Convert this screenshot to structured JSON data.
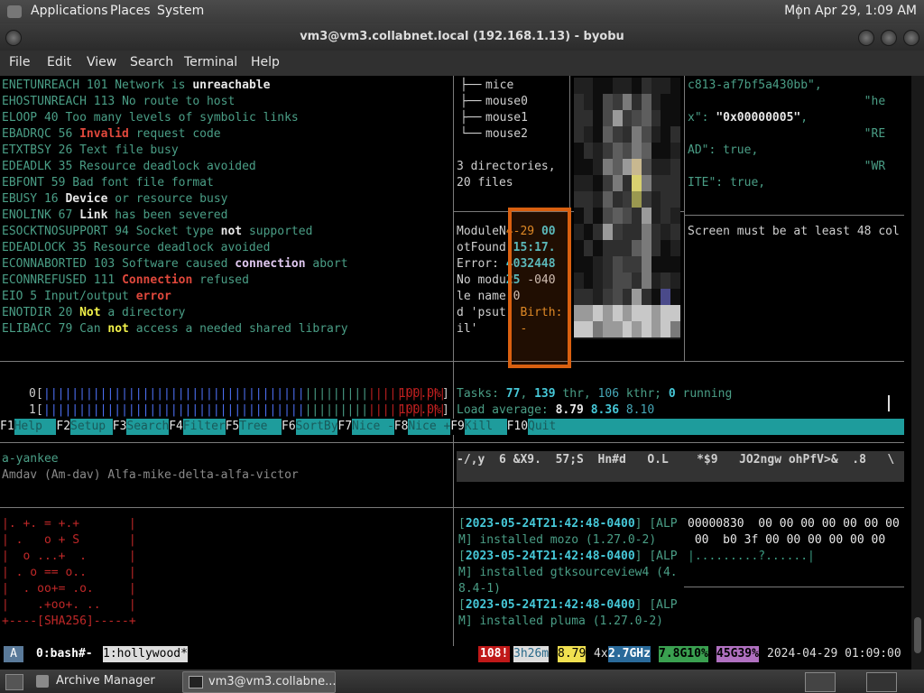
{
  "top_panel": {
    "menus": [
      "Applications",
      "Places",
      "System"
    ],
    "clock": "Mon Apr 29,  1:09 AM"
  },
  "window": {
    "title": "vm3@vm3.collabnet.local (192.168.1.13) - byobu"
  },
  "menubar": [
    "File",
    "Edit",
    "View",
    "Search",
    "Terminal",
    "Help"
  ],
  "errno_pane": [
    [
      [
        "ENETUNREACH 101 ",
        "g"
      ],
      [
        "Network is ",
        "g"
      ],
      [
        "unreachable",
        "w"
      ]
    ],
    [
      [
        "EHOSTUNREACH 113 ",
        "g"
      ],
      [
        "No route to host",
        "g"
      ]
    ],
    [
      [
        "ELOOP 40 ",
        "g"
      ],
      [
        "Too many levels of symbolic links",
        "g"
      ]
    ],
    [
      [
        "EBADRQC 56 ",
        "g"
      ],
      [
        "Invalid",
        "r"
      ],
      [
        " request code",
        "g"
      ]
    ],
    [
      [
        "ETXTBSY 26 ",
        "g"
      ],
      [
        "Text file busy",
        "g"
      ]
    ],
    [
      [
        "EDEADLK 35 ",
        "g"
      ],
      [
        "Resource deadlock avoided",
        "g"
      ]
    ],
    [
      [
        "EBFONT 59 ",
        "g"
      ],
      [
        "Bad font file format",
        "g"
      ]
    ],
    [
      [
        "EBUSY 16 ",
        "g"
      ],
      [
        "Device",
        "w"
      ],
      [
        " or resource busy",
        "g"
      ]
    ],
    [
      [
        "ENOLINK 67 ",
        "g"
      ],
      [
        "Link",
        "w"
      ],
      [
        " has been severed",
        "g"
      ]
    ],
    [
      [
        "ESOCKTNOSUPPORT 94 ",
        "g"
      ],
      [
        "Socket type ",
        "g"
      ],
      [
        "not",
        "w"
      ],
      [
        " supported",
        "g"
      ]
    ],
    [
      [
        "EDEADLOCK 35 ",
        "g"
      ],
      [
        "Resource deadlock avoided",
        "g"
      ]
    ],
    [
      [
        "ECONNABORTED 103 ",
        "g"
      ],
      [
        "Software caused ",
        "g"
      ],
      [
        "connection",
        "pk"
      ],
      [
        " abort",
        "g"
      ]
    ],
    [
      [
        "ECONNREFUSED 111 ",
        "g"
      ],
      [
        "Connection",
        "r"
      ],
      [
        " refused",
        "g"
      ]
    ],
    [
      [
        "EIO 5 ",
        "g"
      ],
      [
        "Input/output ",
        "g"
      ],
      [
        "error",
        "r"
      ]
    ],
    [
      [
        "ENOTDIR 20 ",
        "g"
      ],
      [
        "Not",
        "y"
      ],
      [
        " a directory",
        "g"
      ]
    ],
    [
      [
        "ELIBACC 79 ",
        "g"
      ],
      [
        "Can ",
        "g"
      ],
      [
        "not",
        "y"
      ],
      [
        " access a needed shared library",
        "g"
      ]
    ]
  ],
  "tree_pane": {
    "lines": [
      "mice",
      "mouse0",
      "mouse1",
      "mouse2"
    ],
    "summary": [
      "3 directories,",
      "20 files"
    ]
  },
  "py_pane": {
    "lines": [
      [
        [
          "ModuleN",
          "n"
        ],
        [
          "4-29 ",
          "o"
        ],
        [
          "00",
          "cy"
        ]
      ],
      [
        [
          "otFound",
          "n"
        ],
        [
          ":15:17.",
          "cy"
        ]
      ],
      [
        [
          "Error: ",
          "n"
        ],
        [
          "4032448",
          "cy"
        ]
      ],
      [
        [
          "No modu",
          "n"
        ],
        [
          "25 ",
          "cy"
        ],
        [
          "-040",
          "n"
        ]
      ],
      [
        [
          "le name",
          "n"
        ],
        [
          " 0",
          "n"
        ]
      ],
      [
        [
          "d 'psut",
          "n"
        ],
        [
          "  Birth:",
          "o"
        ]
      ],
      [
        [
          "il'    ",
          "n"
        ],
        [
          "  -",
          "o"
        ]
      ]
    ]
  },
  "json_pane": {
    "lines": [
      [
        [
          "c813-af7bf5a430bb\",",
          "g"
        ]
      ],
      [
        [
          "                         \"he",
          "g"
        ]
      ],
      [
        [
          "x\": ",
          "g"
        ],
        [
          "\"0x00000005\"",
          "w"
        ],
        [
          ",",
          "g"
        ]
      ],
      [
        [
          "                         \"RE",
          "g"
        ]
      ],
      [
        [
          "AD\": true,",
          "g"
        ]
      ],
      [
        [
          "                         \"WR",
          "g"
        ]
      ],
      [
        [
          "ITE\": true,",
          "g"
        ]
      ]
    ],
    "warning": "Screen must be at least 48 col"
  },
  "htop": {
    "cpu0_label": "0",
    "cpu1_label": "1",
    "cpu0_pct": "100.0%",
    "cpu1_pct": "100.0%",
    "tasks_label": "Tasks: ",
    "tasks": "77",
    "thr": "139",
    "thr_label": " thr, ",
    "kthr": "106",
    "kthr_label": " kthr; ",
    "running": "0",
    "running_label": " running",
    "load_label": "Load average: ",
    "load1": "8.79",
    "load5": "8.36",
    "load15": "8.10",
    "fkeys": [
      {
        "key": "F1",
        "label": "Help  "
      },
      {
        "key": "F2",
        "label": "Setup "
      },
      {
        "key": "F3",
        "label": "Search"
      },
      {
        "key": "F4",
        "label": "Filter"
      },
      {
        "key": "F5",
        "label": "Tree  "
      },
      {
        "key": "F6",
        "label": "SortBy"
      },
      {
        "key": "F7",
        "label": "Nice -"
      },
      {
        "key": "F8",
        "label": "Nice +"
      },
      {
        "key": "F9",
        "label": "Kill  "
      },
      {
        "key": "F10",
        "label": "Quit"
      }
    ]
  },
  "nato_pane": {
    "line1": "a-yankee",
    "line2": "Amdav (Am-dav) Alfa-mike-delta-alfa-victor"
  },
  "noise_pane": {
    "text": "-/,y  6 &X9.  57;S  Hn#d   O.L    *$9   JO2ngw ohPfV>&  .8   \\"
  },
  "randomart": [
    "|. +. = +.+       |",
    "| .   o + S       |",
    "|  o ...+  .      |",
    "| . o == o..      |",
    "|  . oo+= .o.     |",
    "|    .+oo+. ..    |",
    "+----[SHA256]-----+"
  ],
  "log_pane": [
    [
      [
        "[",
        "g"
      ],
      [
        "2023-05-24T21:42:48-0400",
        "cy"
      ],
      [
        "] [ALP",
        "g"
      ]
    ],
    [
      [
        "M] installed mozo (1.27.0-2)",
        "g"
      ]
    ],
    [
      [
        "[",
        "g"
      ],
      [
        "2023-05-24T21:42:48-0400",
        "cy"
      ],
      [
        "] [ALP",
        "g"
      ]
    ],
    [
      [
        "M] installed gtksourceview4 (4.",
        "g"
      ]
    ],
    [
      [
        "8.4-1)",
        "g"
      ]
    ],
    [
      [
        "[",
        "g"
      ],
      [
        "2023-05-24T21:42:48-0400",
        "cy"
      ],
      [
        "] [ALP",
        "g"
      ]
    ],
    [
      [
        "M] installed pluma (1.27.0-2)",
        "g"
      ]
    ]
  ],
  "hex_pane": [
    "00000830  00 00 00 00 00 00 00",
    " 00  b0 3f 00 00 00 00 00 00",
    "|.........?......|"
  ],
  "status_bar": {
    "session": "A",
    "win0": "0:bash#-",
    "win1": "1:hollywood*",
    "updates": "108!",
    "uptime": "3h26m",
    "load": "8.79",
    "cpu_count": "4x",
    "cpu_freq": "2.7GHz",
    "mem": "7.8G10%",
    "disk": "45G39%",
    "datetime": "2024-04-29 01:09:00"
  },
  "taskbar": {
    "items": [
      "Archive Manager",
      "vm3@vm3.collabne..."
    ]
  },
  "colors": {
    "terminal_bg": "#000000",
    "green": "#4a9e86",
    "cyan": "#46c8d8",
    "orange_highlight": "#d96010",
    "htop_fkey_bg": "#1e9c9c"
  }
}
